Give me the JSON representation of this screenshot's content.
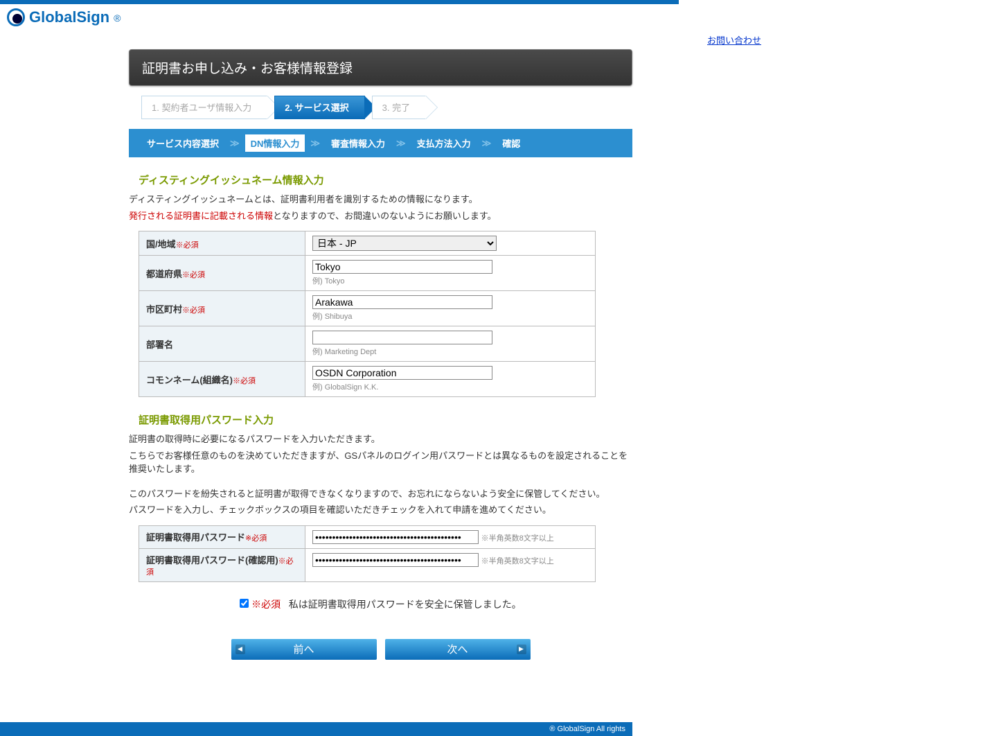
{
  "header": {
    "brand": "GlobalSign",
    "contact_label": "お問い合わせ",
    "page_title": "証明書お申し込み・お客様情報登録"
  },
  "steps": {
    "s1": "1. 契約者ユーザ情報入力",
    "s2": "2. サービス選択",
    "s3": "3. 完了"
  },
  "substeps": {
    "a": "サービス内容選択",
    "b": "DN情報入力",
    "c": "審査情報入力",
    "d": "支払方法入力",
    "e": "確認"
  },
  "dn_section": {
    "title": "ディスティングイッシュネーム情報入力",
    "desc1": "ディスティングイッシュネームとは、証明書利用者を識別するための情報になります。",
    "desc2_red": "発行される証明書に記載される情報",
    "desc2_rest": "となりますので、お間違いのないようにお願いします。",
    "required_mark": "※必須"
  },
  "fields": {
    "country_label": "国/地域",
    "country_value": "日本 - JP",
    "pref_label": "都道府県",
    "pref_value": "Tokyo",
    "pref_hint": "例) Tokyo",
    "city_label": "市区町村",
    "city_value": "Arakawa",
    "city_hint": "例) Shibuya",
    "dept_label": "部署名",
    "dept_value": "",
    "dept_hint": "例) Marketing Dept",
    "cn_label": "コモンネーム(組織名)",
    "cn_value": "OSDN Corporation",
    "cn_hint": "例) GlobalSign K.K."
  },
  "pw_section": {
    "title": "証明書取得用パスワード入力",
    "p1": "証明書の取得時に必要になるパスワードを入力いただきます。",
    "p2": "こちらでお客様任意のものを決めていただきますが、GSパネルのログイン用パスワードとは異なるものを設定されることを推奨いたします。",
    "p3": "このパスワードを紛失されると証明書が取得できなくなりますので、お忘れにならないよう安全に保管してください。",
    "p4": "パスワードを入力し、チェックボックスの項目を確認いただきチェックを入れて申請を進めてください。",
    "pw_label": "証明書取得用パスワード",
    "pw_confirm_label": "証明書取得用パスワード(確認用)",
    "pw_note": "※半角英数8文字以上",
    "pw_value_mask": "●●●●●●●●●●●●●●●●●●●●●●●●●●●●●●●●●●●●●●●●●●●",
    "confirm_required": "※必須",
    "confirm_text": "私は証明書取得用パスワードを安全に保管しました。"
  },
  "nav": {
    "prev": "前へ",
    "next": "次へ"
  },
  "footer": {
    "copyright": "® GlobalSign All rights"
  }
}
